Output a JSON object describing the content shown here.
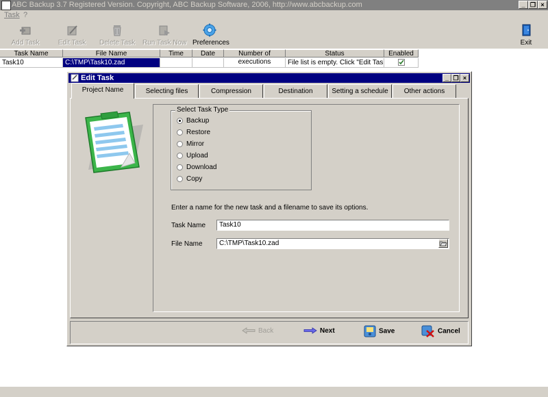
{
  "app": {
    "title": "ABC Backup 3.7  Registered Version.  Copyright,  ABC Backup Software, 2006,  http://www.abcbackup.com",
    "caption_buttons": [
      "_",
      "❐",
      "×"
    ]
  },
  "menu": {
    "task": "Task",
    "help": "?"
  },
  "toolbar": {
    "add_task": "Add Task",
    "edit_task": "Edit Task",
    "delete_task": "Delete Task",
    "run_task_now": "Run Task Now",
    "preferences": "Preferences",
    "exit": "Exit"
  },
  "grid": {
    "headers": {
      "task_name": "Task Name",
      "file_name": "File Name",
      "time": "Time",
      "date": "Date",
      "executions": "Number of executions",
      "status": "Status",
      "enabled": "Enabled"
    },
    "row": {
      "task_name": "Task10",
      "file_name": "C:\\TMP\\Task10.zad",
      "time": "",
      "date": "",
      "executions": "",
      "status": "File list is empty. Click \"Edit Task\" and",
      "enabled": true
    }
  },
  "dialog": {
    "title": "Edit Task",
    "tabs": {
      "project_name": "Project Name",
      "selecting_files": "Selecting files",
      "compression": "Compression",
      "destination": "Destination",
      "schedule": "Setting a schedule",
      "other": "Other actions"
    },
    "task_type": {
      "legend": "Select Task Type",
      "options": {
        "backup": "Backup",
        "restore": "Restore",
        "mirror": "Mirror",
        "upload": "Upload",
        "download": "Download",
        "copy": "Copy"
      },
      "selected": "Backup"
    },
    "instruction": "Enter a name for the new task and a filename to save its options.",
    "task_name_label": "Task Name",
    "task_name_value": "Task10",
    "file_name_label": "File Name",
    "file_name_value": "C:\\TMP\\Task10.zad",
    "buttons": {
      "back": "Back",
      "next": "Next",
      "save": "Save",
      "cancel": "Cancel"
    }
  },
  "colors": {
    "title_bar": "#808080",
    "dialog_title_bar": "#000080",
    "face": "#d4d0c8",
    "selection": "#000080"
  }
}
